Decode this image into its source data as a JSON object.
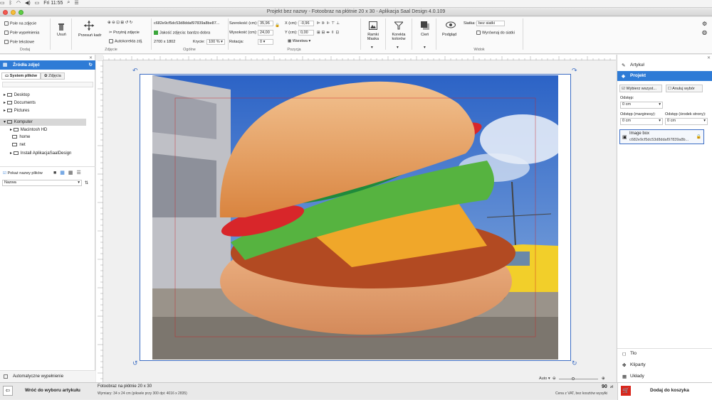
{
  "menubar": {
    "clock": "Fri 11:55"
  },
  "window": {
    "title": "Projekt bez nazwy - Fotoobraz na płótnie 20 x 30 - Aplikacja Saal Design 4.0.109"
  },
  "ribbon": {
    "dodaj": {
      "items": [
        "Pole na zdjęcie",
        "Pole wypełnienia",
        "Pole tekstowe"
      ],
      "label": "Dodaj"
    },
    "usun": "Usuń",
    "zdjecie": {
      "przesun": "Przesuń kadr",
      "przytnij": "Przytnij zdjęcie",
      "autokorekta": "Autokorekta zdj.",
      "label": "Zdjęcie"
    },
    "ogolne": {
      "file_id": "c682e9cf5dc53d8ddaf97839a8be87...",
      "quality": "Jakość zdjęcia: bardzo dobra",
      "size": "2700 x 1802",
      "label": "Ogólne",
      "krycie_label": "Krycie:",
      "krycie": "100 %"
    },
    "pozycja": {
      "szerokosc_label": "Szerokość (cm):",
      "szerokosc": "35,96",
      "wysokosc_label": "Wysokość (cm):",
      "wysokosc": "24,00",
      "rotacja_label": "Rotacja:",
      "rotacja": "0",
      "x_label": "X (cm):",
      "x": "-0,96",
      "y_label": "Y (cm):",
      "y": "0,00",
      "warstwa": "Warstwa",
      "label": "Pozycja"
    },
    "ramki": "Ramki Maska",
    "korekta": "Korekta kolorów",
    "cien": "Cień",
    "podglad": "Podgląd",
    "widok": {
      "siatka_label": "Siatka:",
      "siatka": "bez siatki",
      "wyrownaj": "Wyrównaj do siatki",
      "label": "Widok"
    }
  },
  "left": {
    "title": "Źródła zdjęć",
    "tabs": [
      "System plików",
      "Zdjęcia"
    ],
    "tree": [
      "Desktop",
      "Documents",
      "Pictures",
      "Komputer",
      "Macintosh HD",
      "home",
      "net",
      "Install AplikacjaSaalDesign"
    ],
    "pokaz": "Pokaż nazwy plików",
    "sort": "Nazwa",
    "auto": "Automatyczne wypełnienie",
    "back": "Wróć do wyboru artykułu"
  },
  "right": {
    "artykul": "Artykuł",
    "projekt": "Projekt",
    "wybierz": "Wybierz wszyst...",
    "anuluj": "Anuluj wybór",
    "odstep_label": "Odstęp:",
    "odstep": "0 cm",
    "margins_label": "Odstęp (marginesy):",
    "margins": "0 cm",
    "srodek_label": "Odstęp (środek strony):",
    "srodek": "0 cm",
    "imagebox_title": "Image box",
    "imagebox_id": "c682e9cf5dc53d8ddaf97839a8b...",
    "tlo": "Tło",
    "kliparty": "Kliparty",
    "uklady": "Układy",
    "koszyk": "Dodaj do koszyka"
  },
  "canvas": {
    "zoom": "Auto"
  },
  "bottom": {
    "product": "Fotoobraz na płótnie 20 x 30",
    "dims": "Wymiary: 34 x 24 cm (piksele przy 300 dpi: 4016 x 2835)",
    "price": "90",
    "currency": "zł",
    "vat": "Cena z VAT, bez kosztów wysyłki"
  },
  "colors": {
    "accent": "#2e7bd6",
    "selection": "#3c6dc4",
    "cart": "#d9261c"
  }
}
